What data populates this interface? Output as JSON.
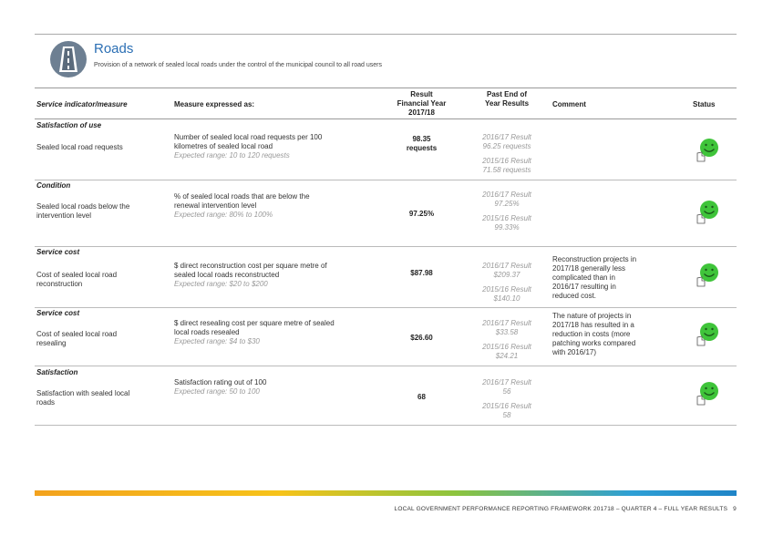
{
  "header": {
    "title": "Roads",
    "subtitle": "Provision of a network of sealed local roads under the control of the municipal council to all road users",
    "icon": "road-icon"
  },
  "table": {
    "columns": {
      "indicator": "Service indicator/measure",
      "measure": "Measure expressed as:",
      "result": [
        "Result",
        "Financial Year",
        "2017/18"
      ],
      "past": [
        "Past End of",
        "Year Results"
      ],
      "comment": "Comment",
      "status": "Status"
    },
    "rows": [
      {
        "category": "Satisfaction of use",
        "indicator": [
          "Sealed local road requests"
        ],
        "measure": [
          "Number of sealed local road requests per 100",
          "kilometres of sealed local road"
        ],
        "range": "Expected range: 10 to 120 requests",
        "result": [
          "98.35",
          "requests"
        ],
        "past": [
          "2016/17 Result",
          "96.25 requests",
          "2015/16 Result",
          "71.58 requests"
        ],
        "comment": [],
        "status": "smiley-icon"
      },
      {
        "category": "Condition",
        "indicator": [
          "Sealed local roads below the",
          "intervention level"
        ],
        "measure": [
          "% of sealed local roads that are below the",
          "renewal intervention level"
        ],
        "range": "Expected range: 80% to 100%",
        "result": [
          "97.25%"
        ],
        "past": [
          "2016/17 Result",
          "97.25%",
          "2015/16 Result",
          "99.33%"
        ],
        "comment": [],
        "status": "smiley-icon"
      },
      {
        "category": "Service cost",
        "indicator": [
          "Cost of sealed local road",
          "reconstruction"
        ],
        "measure": [
          "$ direct reconstruction cost per square metre of",
          "sealed local roads reconstructed"
        ],
        "range": "Expected range: $20 to $200",
        "result": [
          "$87.98"
        ],
        "past": [
          "2016/17 Result",
          "$209.37",
          "2015/16 Result",
          "$140.10"
        ],
        "comment": [
          "Reconstruction projects in",
          "2017/18 generally less",
          "complicated than in",
          "2016/17 resulting in",
          "reduced cost."
        ],
        "status": "smiley-icon"
      },
      {
        "category": "Service cost",
        "indicator": [
          "Cost of sealed local road",
          "resealing"
        ],
        "measure": [
          "$ direct resealing cost per square metre of sealed",
          "local roads resealed"
        ],
        "range": "Expected range: $4 to $30",
        "result": [
          "$26.60"
        ],
        "past": [
          "2016/17 Result",
          "$33.58",
          "2015/16 Result",
          "$24.21"
        ],
        "comment": [
          "The nature of projects in",
          "2017/18 has resulted in a",
          "reduction in costs (more",
          "patching works compared",
          "with 2016/17)"
        ],
        "status": "smiley-icon"
      },
      {
        "category": "Satisfaction",
        "indicator": [
          "Satisfaction with sealed local",
          "roads"
        ],
        "measure": [
          "Satisfaction rating out of 100"
        ],
        "range": "Expected range: 50 to 100",
        "result": [
          "68"
        ],
        "past": [
          "2016/17 Result",
          "56",
          "2015/16 Result",
          "58"
        ],
        "comment": [],
        "status": "smiley-icon"
      }
    ]
  },
  "footer": {
    "text": "LOCAL GOVERNMENT PERFORMANCE REPORTING FRAMEWORK 201718 – QUARTER 4 – FULL YEAR RESULTS",
    "page": "9"
  },
  "colors": {
    "title": "#2b6fb4",
    "smiley": "#3fc43a",
    "icon": "#6d7f92"
  }
}
